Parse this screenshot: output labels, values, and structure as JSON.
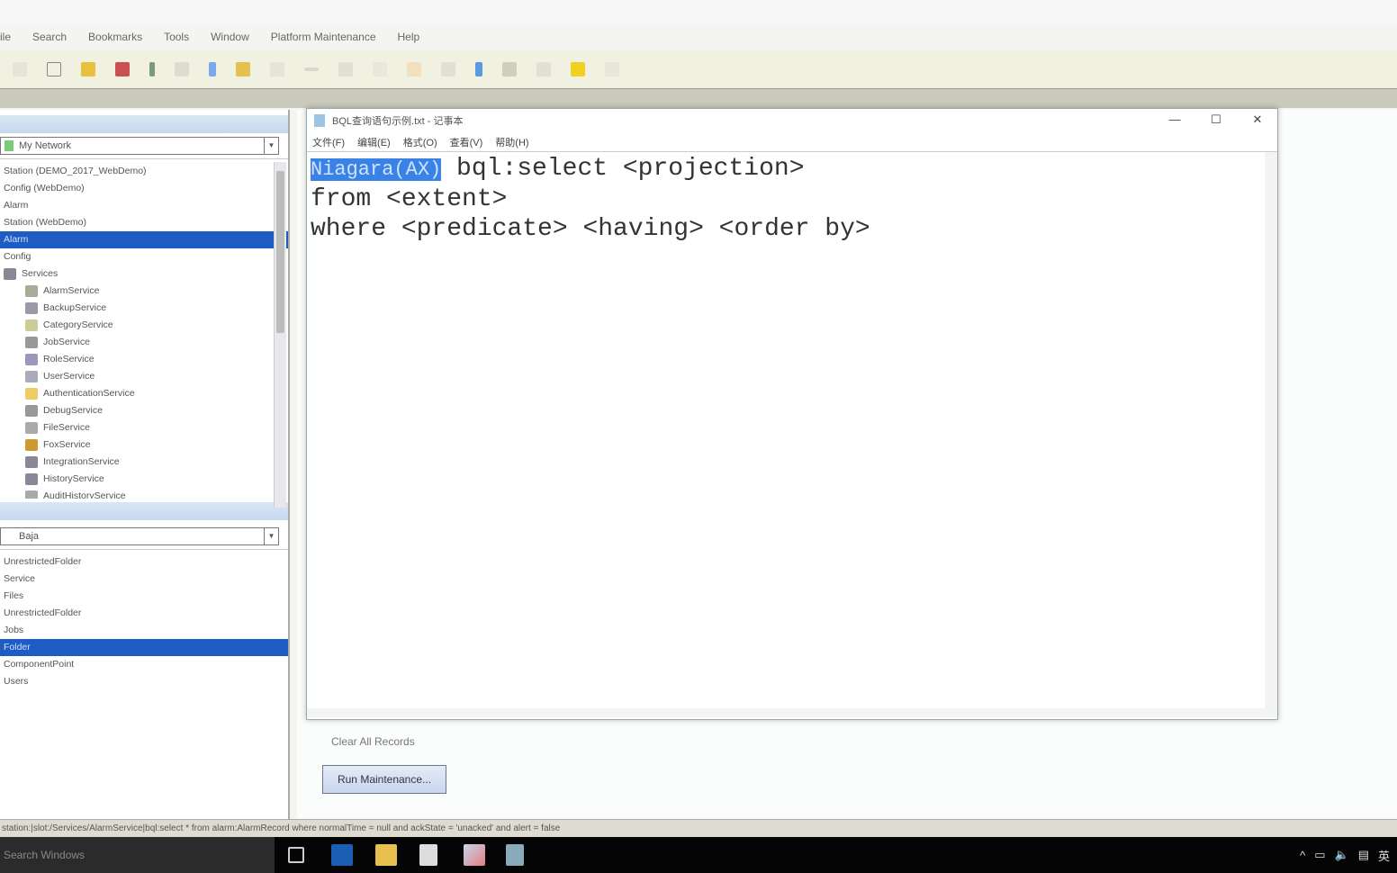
{
  "menubar": {
    "items": [
      "ile",
      "Search",
      "Bookmarks",
      "Tools",
      "Window",
      "Platform Maintenance",
      "Help"
    ]
  },
  "left": {
    "nav_selector": "My Network",
    "tree": [
      {
        "label": "Station (DEMO_2017_WebDemo)",
        "selected": false
      },
      {
        "label": "Config (WebDemo)",
        "selected": false
      },
      {
        "label": "Alarm",
        "selected": false
      },
      {
        "label": "Station (WebDemo)",
        "selected": false
      },
      {
        "label": "Alarm",
        "selected": true
      },
      {
        "label": "Config",
        "selected": false
      },
      {
        "label": "Services",
        "selected": false
      },
      {
        "label": "AlarmService",
        "selected": false
      },
      {
        "label": "BackupService",
        "selected": false
      },
      {
        "label": "CategoryService",
        "selected": false
      },
      {
        "label": "JobService",
        "selected": false
      },
      {
        "label": "RoleService",
        "selected": false
      },
      {
        "label": "UserService",
        "selected": false
      },
      {
        "label": "AuthenticationService",
        "selected": false
      },
      {
        "label": "DebugService",
        "selected": false
      },
      {
        "label": "FileService",
        "selected": false
      },
      {
        "label": "FoxService",
        "selected": false
      },
      {
        "label": "IntegrationService",
        "selected": false
      },
      {
        "label": "HistoryService",
        "selected": false
      },
      {
        "label": "AuditHistoryService",
        "selected": false
      }
    ],
    "palette_selector": "Baja",
    "palette": [
      {
        "label": "UnrestrictedFolder",
        "selected": false
      },
      {
        "label": "Service",
        "selected": false
      },
      {
        "label": "Files",
        "selected": false
      },
      {
        "label": "UnrestrictedFolder",
        "selected": false
      },
      {
        "label": "Jobs",
        "selected": false
      },
      {
        "label": "Folder",
        "selected": true
      },
      {
        "label": "ComponentPoint",
        "selected": false
      },
      {
        "label": "Users",
        "selected": false
      }
    ]
  },
  "notepad": {
    "title": "BQL查询语句示例.txt - 记事本",
    "menu": [
      "文件(F)",
      "编辑(E)",
      "格式(O)",
      "查看(V)",
      "帮助(H)"
    ],
    "selected_text": "Niagara(AX)",
    "lines": [
      " bql:select <projection>",
      "from <extent>",
      "where <predicate> <having> <order by>"
    ],
    "minimize": "—",
    "maximize": "☐",
    "close": "✕"
  },
  "main": {
    "clear_label": "Clear All Records",
    "run_button": "Run Maintenance..."
  },
  "statusbar": "station:|slot:/Services/AlarmService|bql:select * from alarm:AlarmRecord where normalTime = null and ackState = 'unacked' and alert = false",
  "taskbar": {
    "search_placeholder": "Search Windows",
    "tray_lang": "英"
  }
}
